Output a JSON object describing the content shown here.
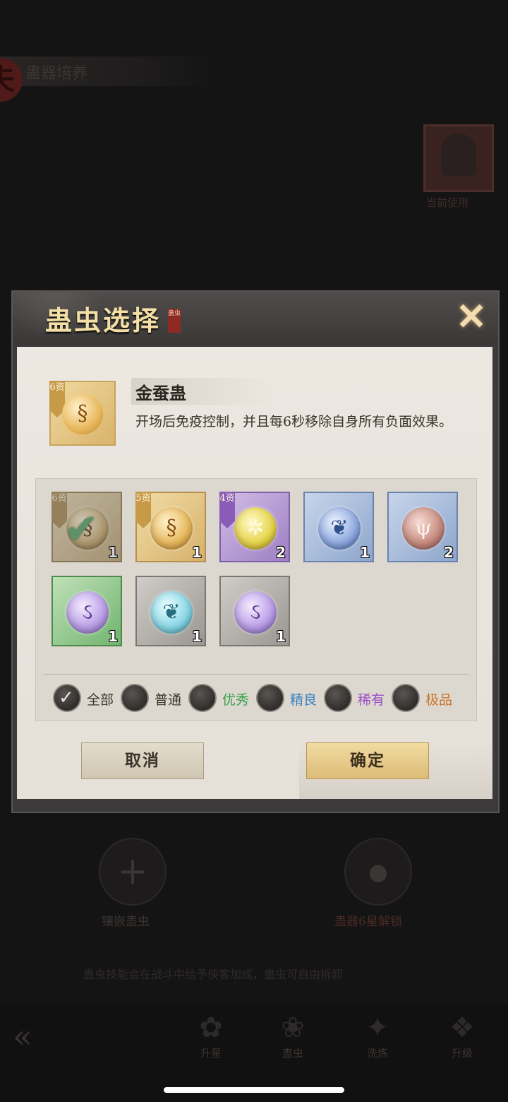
{
  "background": {
    "header_title": "蛊器培养",
    "seal_char": "夫",
    "portrait_label": "当前使用",
    "left_slot_label": "镶嵌蛊虫",
    "right_slot_label": "蛊器6星解锁",
    "description": "蛊虫技能会在战斗中给予侠客加成，蛊虫可自由拆卸",
    "nav": [
      "升星",
      "蛊虫",
      "洗炼",
      "升级"
    ]
  },
  "dialog": {
    "title": "蛊虫选择",
    "title_seal": "蛊虫",
    "selected": {
      "name": "金蚕蛊",
      "grade": "6资",
      "description": "开场后免疫控制，并且每6秒移除自身所有负面效果。",
      "icon": "golden-silkworm-icon"
    },
    "items": [
      {
        "grade": "6资",
        "count": "1",
        "selected": true,
        "rarity": "gold",
        "icon": "golden-silkworm-icon"
      },
      {
        "grade": "5资",
        "count": "1",
        "selected": false,
        "rarity": "gold",
        "icon": "golden-silkworm-icon"
      },
      {
        "grade": "4资",
        "count": "2",
        "selected": false,
        "rarity": "purple",
        "icon": "golden-scorpion-icon"
      },
      {
        "grade": "",
        "count": "1",
        "selected": false,
        "rarity": "blue",
        "icon": "blue-butterfly-icon"
      },
      {
        "grade": "",
        "count": "2",
        "selected": false,
        "rarity": "blue",
        "icon": "red-coral-icon"
      },
      {
        "grade": "",
        "count": "1",
        "selected": false,
        "rarity": "green",
        "icon": "purple-snake-icon"
      },
      {
        "grade": "",
        "count": "1",
        "selected": false,
        "rarity": "gray",
        "icon": "cyan-butterfly-icon"
      },
      {
        "grade": "",
        "count": "1",
        "selected": false,
        "rarity": "gray",
        "icon": "purple-snake-icon"
      }
    ],
    "filters": [
      {
        "label": "全部",
        "color": "#3a332c",
        "checked": true
      },
      {
        "label": "普通",
        "color": "#3a332c",
        "checked": false
      },
      {
        "label": "优秀",
        "color": "#3aa04e",
        "checked": false
      },
      {
        "label": "精良",
        "color": "#3a7fc0",
        "checked": false
      },
      {
        "label": "稀有",
        "color": "#9b4fc4",
        "checked": false
      },
      {
        "label": "极品",
        "color": "#c9752a",
        "checked": false
      }
    ],
    "cancel_label": "取消",
    "confirm_label": "确定"
  }
}
